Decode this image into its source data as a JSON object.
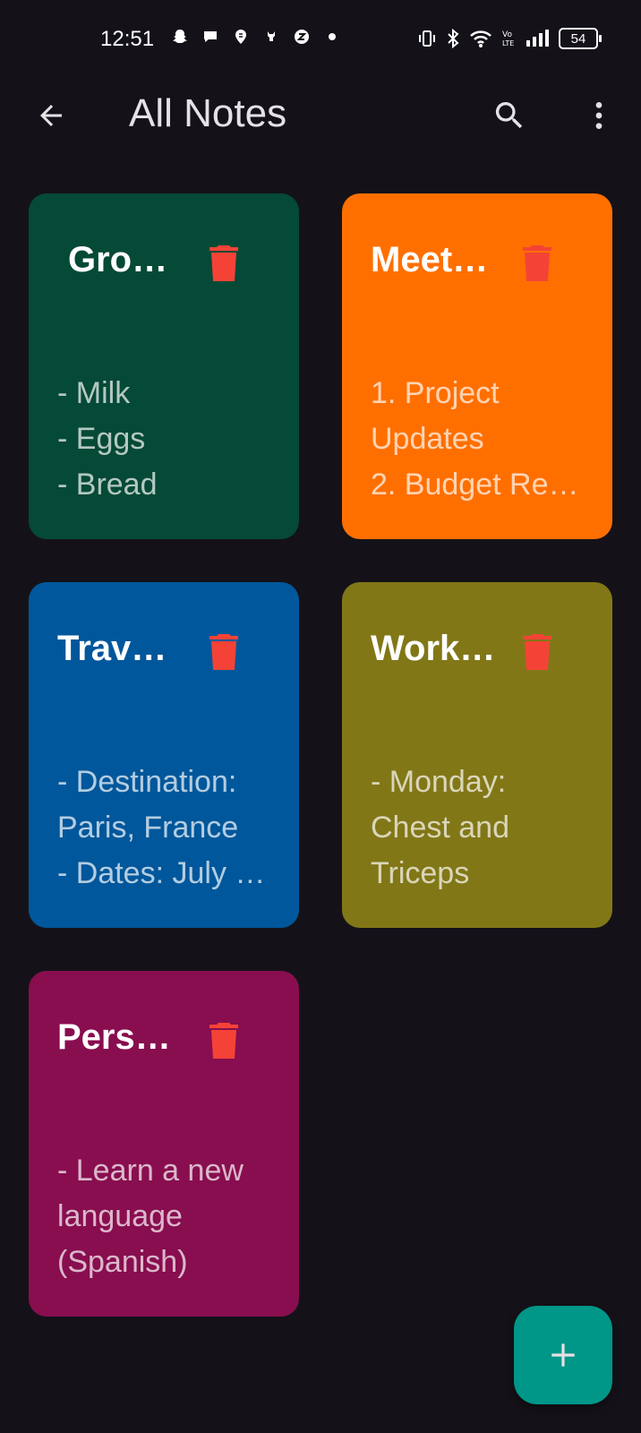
{
  "status_bar": {
    "time": "12:51",
    "battery": "54",
    "left_icons": [
      "snapchat-icon",
      "chat-bubble-icon",
      "swiggy-icon",
      "notification-icon",
      "app-icon",
      "dot-icon"
    ],
    "right_icons": [
      "vibrate-icon",
      "bluetooth-icon",
      "wifi-icon",
      "volte-icon",
      "signal-icon",
      "battery-icon"
    ]
  },
  "app_bar": {
    "title": "All Notes",
    "back_icon": "arrow-back-icon",
    "search_icon": "search-icon",
    "more_icon": "more-vert-icon"
  },
  "notes": [
    {
      "title": "Gro…",
      "color": "#054937",
      "lines": [
        "- Milk",
        "- Eggs",
        "- Bread"
      ]
    },
    {
      "title": "Meet…",
      "color": "#ff6f00",
      "lines": [
        "1. Project",
        "Updates",
        "2. Budget Re…"
      ]
    },
    {
      "title": "Trav…",
      "color": "#01579b",
      "lines": [
        "- Destination:",
        "Paris, France",
        "- Dates: July …"
      ]
    },
    {
      "title": "Work…",
      "color": "#827717",
      "lines": [
        "- Monday:",
        "Chest and",
        "Triceps"
      ]
    },
    {
      "title": "Pers…",
      "color": "#880e4f",
      "lines": [
        "- Learn a new",
        "language",
        "(Spanish)"
      ]
    }
  ],
  "colors": {
    "background": "#141218",
    "delete_icon": "#f44336",
    "fab": "#009688"
  },
  "fab": {
    "icon": "add-icon"
  }
}
